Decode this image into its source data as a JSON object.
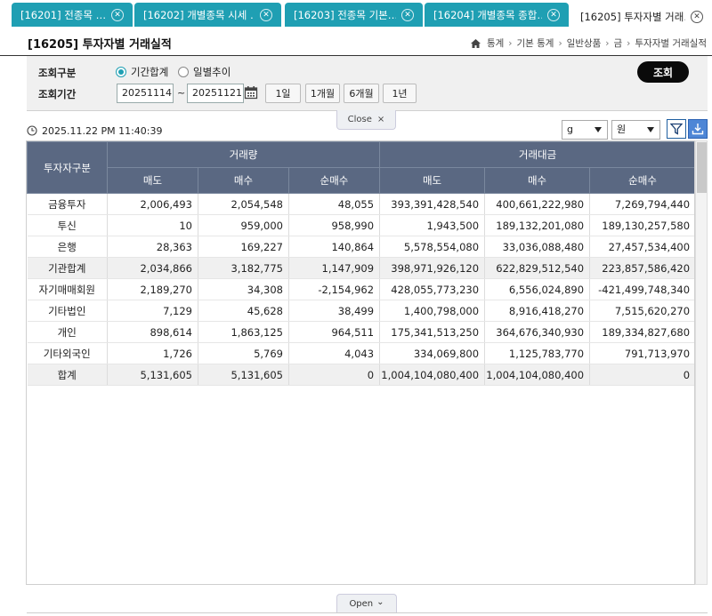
{
  "tabs": [
    {
      "label": "[16201] 전종목 …"
    },
    {
      "label": "[16202] 개별종목 시세 …"
    },
    {
      "label": "[16203] 전종목 기본…"
    },
    {
      "label": "[16204] 개별종목 종합…"
    },
    {
      "label": "[16205] 투자자별 거래…"
    }
  ],
  "page": {
    "title": "[16205] 투자자별 거래실적"
  },
  "breadcrumb": [
    "통계",
    "기본 통계",
    "일반상품",
    "금",
    "투자자별 거래실적"
  ],
  "search": {
    "type_label": "조회구분",
    "period_label": "조회기간",
    "radio_period_total": "기간합계",
    "radio_daily_trend": "일별추이",
    "start_date": "20251114",
    "end_date": "20251121",
    "tilde": "~",
    "period_buttons": [
      "1일",
      "1개월",
      "6개월",
      "1년"
    ],
    "inquiry_button": "조회",
    "close_label": "Close",
    "close_icon": "×"
  },
  "timestamp": "2025.11.22 PM 11:40:39",
  "unit_select": "g",
  "currency_select": "원",
  "icons": {
    "filter": "filter-icon",
    "download": "download-icon",
    "clock": "clock-icon",
    "calendar": "calendar-icon",
    "home": "home-icon"
  },
  "colors": {
    "tab": "#1f9fb3",
    "header": "#5a6882",
    "accent_blue": "#4e86d6"
  },
  "table": {
    "col_investor": "투자자구분",
    "group_volume": "거래량",
    "group_amount": "거래대금",
    "sub_headers": [
      "매도",
      "매수",
      "순매수",
      "매도",
      "매수",
      "순매수"
    ],
    "rows": [
      {
        "cat": "금융투자",
        "v": [
          "2,006,493",
          "2,054,548",
          "48,055",
          "393,391,428,540",
          "400,661,222,980",
          "7,269,794,440"
        ]
      },
      {
        "cat": "투신",
        "v": [
          "10",
          "959,000",
          "958,990",
          "1,943,500",
          "189,132,201,080",
          "189,130,257,580"
        ]
      },
      {
        "cat": "은행",
        "v": [
          "28,363",
          "169,227",
          "140,864",
          "5,578,554,080",
          "33,036,088,480",
          "27,457,534,400"
        ]
      },
      {
        "cat": "기관합계",
        "v": [
          "2,034,866",
          "3,182,775",
          "1,147,909",
          "398,971,926,120",
          "622,829,512,540",
          "223,857,586,420"
        ],
        "sum": true
      },
      {
        "cat": "자기매매회원",
        "v": [
          "2,189,270",
          "34,308",
          "-2,154,962",
          "428,055,773,230",
          "6,556,024,890",
          "-421,499,748,340"
        ]
      },
      {
        "cat": "기타법인",
        "v": [
          "7,129",
          "45,628",
          "38,499",
          "1,400,798,000",
          "8,916,418,270",
          "7,515,620,270"
        ]
      },
      {
        "cat": "개인",
        "v": [
          "898,614",
          "1,863,125",
          "964,511",
          "175,341,513,250",
          "364,676,340,930",
          "189,334,827,680"
        ]
      },
      {
        "cat": "기타외국인",
        "v": [
          "1,726",
          "5,769",
          "4,043",
          "334,069,800",
          "1,125,783,770",
          "791,713,970"
        ]
      },
      {
        "cat": "합계",
        "v": [
          "5,131,605",
          "5,131,605",
          "0",
          "1,004,104,080,400",
          "1,004,104,080,400",
          "0"
        ],
        "sum": true
      }
    ]
  },
  "open_label": "Open",
  "open_icon": "⌄"
}
